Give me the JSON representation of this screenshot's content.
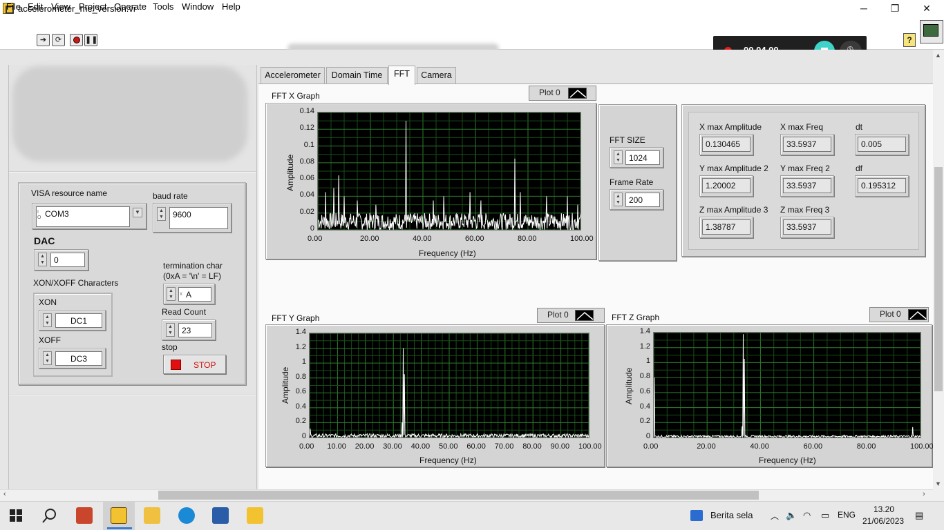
{
  "window": {
    "title": "accelerometer_me_version.vi",
    "controls": [
      "─",
      "❐",
      "✕"
    ]
  },
  "menu": [
    "File",
    "Edit",
    "View",
    "Project",
    "Operate",
    "Tools",
    "Window",
    "Help"
  ],
  "toolbar": {
    "help": "?"
  },
  "recorder": {
    "time": "00.04.00"
  },
  "config": {
    "visa_label": "VISA resource name",
    "visa_value": "COM3",
    "baud_label": "baud rate",
    "baud_value": "9600",
    "dac_label": "DAC",
    "dac_value": "0",
    "xonxoff_label": "XON/XOFF Characters",
    "xon_label": "XON",
    "xon_value": "DC1",
    "xoff_label": "XOFF",
    "xoff_value": "DC3",
    "term_label_1": "termination char",
    "term_label_2": "(0xA = '\\n' = LF)",
    "term_value": "A",
    "read_count_label": "Read Count",
    "read_count_value": "23",
    "stop_label": "stop",
    "stop_button": "STOP"
  },
  "tabs": [
    "Accelerometer",
    "Domain Time",
    "FFT",
    "Camera"
  ],
  "active_tab": "FFT",
  "fft_settings": {
    "size_label": "FFT SIZE",
    "size_value": "1024",
    "rate_label": "Frame Rate",
    "rate_value": "200"
  },
  "indicators": {
    "x_amp_label": "X max Amplitude",
    "x_amp_value": "0.130465",
    "x_freq_label": "X max Freq",
    "x_freq_value": "33.5937",
    "dt_label": "dt",
    "dt_value": "0.005",
    "y_amp_label": "Y max Amplitude 2",
    "y_amp_value": "1.20002",
    "y_freq_label": "Y max Freq 2",
    "y_freq_value": "33.5937",
    "df_label": "df",
    "df_value": "0.195312",
    "z_amp_label": "Z max Amplitude 3",
    "z_amp_value": "1.38787",
    "z_freq_label": "Z max Freq 3",
    "z_freq_value": "33.5937"
  },
  "graphs": {
    "x": {
      "title": "FFT X Graph",
      "legend": "Plot 0",
      "xlabel": "Frequency (Hz)",
      "ylabel": "Amplitude"
    },
    "y": {
      "title": "FFT Y  Graph",
      "legend": "Plot 0",
      "xlabel": "Frequency (Hz)",
      "ylabel": "Amplitude"
    },
    "z": {
      "title": "FFT Z  Graph",
      "legend": "Plot 0",
      "xlabel": "Frequency (Hz)",
      "ylabel": "Amplitude"
    }
  },
  "chart_data": [
    {
      "type": "line",
      "title": "FFT X Graph",
      "xlabel": "Frequency (Hz)",
      "ylabel": "Amplitude",
      "xlim": [
        0,
        100
      ],
      "ylim": [
        0,
        0.14
      ],
      "x_ticks": [
        "0.00",
        "20.00",
        "40.00",
        "60.00",
        "80.00",
        "100.00"
      ],
      "y_ticks": [
        "0",
        "0.02",
        "0.04",
        "0.06",
        "0.08",
        "0.1",
        "0.12",
        "0.14"
      ],
      "grid": true,
      "color": "#ffffff",
      "noise_level": 0.02,
      "peaks": [
        [
          3,
          0.045
        ],
        [
          6,
          0.05
        ],
        [
          8,
          0.065
        ],
        [
          10,
          0.04
        ],
        [
          15,
          0.035
        ],
        [
          22,
          0.03
        ],
        [
          33.6,
          0.13
        ],
        [
          44,
          0.035
        ],
        [
          48,
          0.04
        ],
        [
          58,
          0.045
        ],
        [
          62,
          0.035
        ],
        [
          75,
          0.085
        ],
        [
          77,
          0.045
        ],
        [
          87,
          0.04
        ],
        [
          95,
          0.04
        ],
        [
          99,
          0.03
        ]
      ],
      "series": [
        {
          "name": "Plot 0"
        }
      ]
    },
    {
      "type": "line",
      "title": "FFT Y  Graph",
      "xlabel": "Frequency (Hz)",
      "ylabel": "Amplitude",
      "xlim": [
        0,
        100
      ],
      "ylim": [
        0,
        1.4
      ],
      "x_ticks": [
        "0.00",
        "10.00",
        "20.00",
        "30.00",
        "40.00",
        "50.00",
        "60.00",
        "70.00",
        "80.00",
        "90.00",
        "100.00"
      ],
      "y_ticks": [
        "0",
        "0.2",
        "0.4",
        "0.6",
        "0.8",
        "1",
        "1.2",
        "1.4"
      ],
      "grid": true,
      "color": "#ffffff",
      "noise_level": 0.05,
      "peaks": [
        [
          33.6,
          1.2
        ],
        [
          34,
          0.85
        ],
        [
          33.2,
          0.2
        ],
        [
          0.2,
          0.12
        ]
      ],
      "series": [
        {
          "name": "Plot 0"
        }
      ]
    },
    {
      "type": "line",
      "title": "FFT Z  Graph",
      "xlabel": "Frequency (Hz)",
      "ylabel": "Amplitude",
      "xlim": [
        0,
        100
      ],
      "ylim": [
        0,
        1.4
      ],
      "x_ticks": [
        "0.00",
        "20.00",
        "40.00",
        "60.00",
        "80.00",
        "100.00"
      ],
      "y_ticks": [
        "0",
        "0.2",
        "0.4",
        "0.6",
        "0.8",
        "1",
        "1.2",
        "1.4"
      ],
      "grid": true,
      "color": "#ffffff",
      "noise_level": 0.03,
      "peaks": [
        [
          33.6,
          1.38
        ],
        [
          34,
          1.05
        ],
        [
          33.2,
          0.15
        ],
        [
          0.2,
          0.8
        ],
        [
          97,
          0.14
        ]
      ],
      "series": [
        {
          "name": "Plot 0"
        }
      ]
    }
  ],
  "taskbar": {
    "weather": "Berita sela",
    "lang": "ENG",
    "time": "13.20",
    "date": "21/06/2023"
  }
}
